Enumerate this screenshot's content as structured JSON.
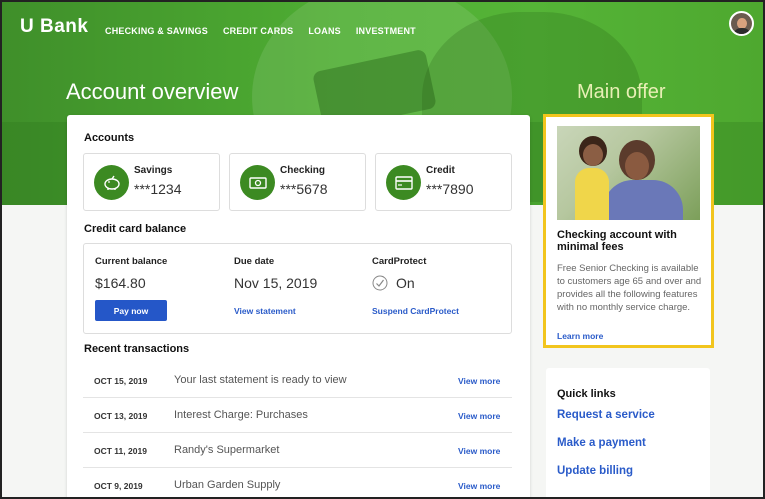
{
  "header": {
    "logo": "U Bank",
    "nav": [
      "CHECKING & SAVINGS",
      "CREDIT CARDS",
      "LOANS",
      "INVESTMENT"
    ],
    "page_title": "Account overview",
    "offer_heading": "Main offer"
  },
  "accounts": {
    "heading": "Accounts",
    "items": [
      {
        "name": "Savings",
        "number": "***1234",
        "icon": "piggy-bank-icon"
      },
      {
        "name": "Checking",
        "number": "***5678",
        "icon": "cash-icon"
      },
      {
        "name": "Credit",
        "number": "***7890",
        "icon": "credit-card-icon"
      }
    ]
  },
  "credit_card": {
    "heading": "Credit card balance",
    "current_balance_label": "Current balance",
    "current_balance": "$164.80",
    "pay_button": "Pay now",
    "due_date_label": "Due date",
    "due_date": "Nov 15, 2019",
    "view_statement": "View statement",
    "cardprotect_label": "CardProtect",
    "cardprotect_status": "On",
    "suspend_link": "Suspend CardProtect"
  },
  "transactions": {
    "heading": "Recent transactions",
    "view_more": "View more",
    "rows": [
      {
        "date": "OCT 15, 2019",
        "description": "Your last statement is ready to view"
      },
      {
        "date": "OCT 13, 2019",
        "description": "Interest Charge: Purchases"
      },
      {
        "date": "OCT 11, 2019",
        "description": "Randy's Supermarket"
      },
      {
        "date": "OCT 9, 2019",
        "description": "Urban Garden Supply"
      }
    ]
  },
  "offer": {
    "title": "Checking account with minimal fees",
    "body": "Free Senior Checking is available to customers age 65 and over and provides all the following features with no monthly service charge.",
    "link": "Learn more"
  },
  "quick_links": {
    "heading": "Quick links",
    "links": [
      "Request a service",
      "Make a payment",
      "Update billing"
    ]
  },
  "colors": {
    "brand_green": "#4fae33",
    "link_blue": "#2a5bc9",
    "offer_border": "#f2c51d"
  }
}
